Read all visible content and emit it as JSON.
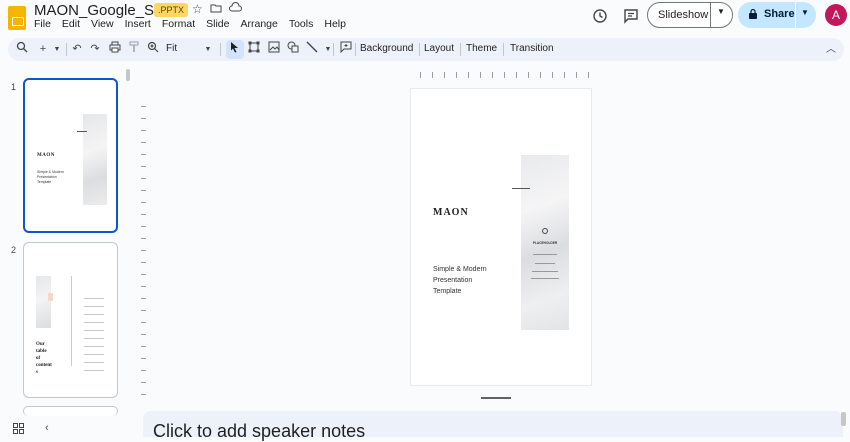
{
  "header": {
    "doc_title": "MAON_Google_Slides",
    "file_badge": ".PPTX",
    "menu": [
      "File",
      "Edit",
      "View",
      "Insert",
      "Format",
      "Slide",
      "Arrange",
      "Tools",
      "Help"
    ],
    "slideshow_label": "Slideshow",
    "share_label": "Share",
    "avatar_initial": "A"
  },
  "toolbar": {
    "zoom_value": "Fit",
    "background_label": "Background",
    "layout_label": "Layout",
    "theme_label": "Theme",
    "transition_label": "Transition"
  },
  "filmstrip": {
    "slides": [
      {
        "number": "1",
        "title": "MAON",
        "subtitle": "Simple & Modern Presentation Template"
      },
      {
        "number": "2",
        "title_lines": [
          "Our",
          "table",
          "of",
          "content",
          "s"
        ]
      }
    ]
  },
  "slide": {
    "title": "MAON",
    "subtitle_lines": [
      "Simple & Modern",
      "Presentation",
      "Template"
    ],
    "photo_caption": "PLACEHOLDER"
  },
  "notes": {
    "placeholder": "Click to add speaker notes"
  },
  "colors": {
    "accent": "#0b57d0",
    "share_bg": "#c2e7ff",
    "badge_bg": "#fdd663",
    "avatar_bg": "#c2185b",
    "toolbar_bg": "#edf2fa"
  }
}
